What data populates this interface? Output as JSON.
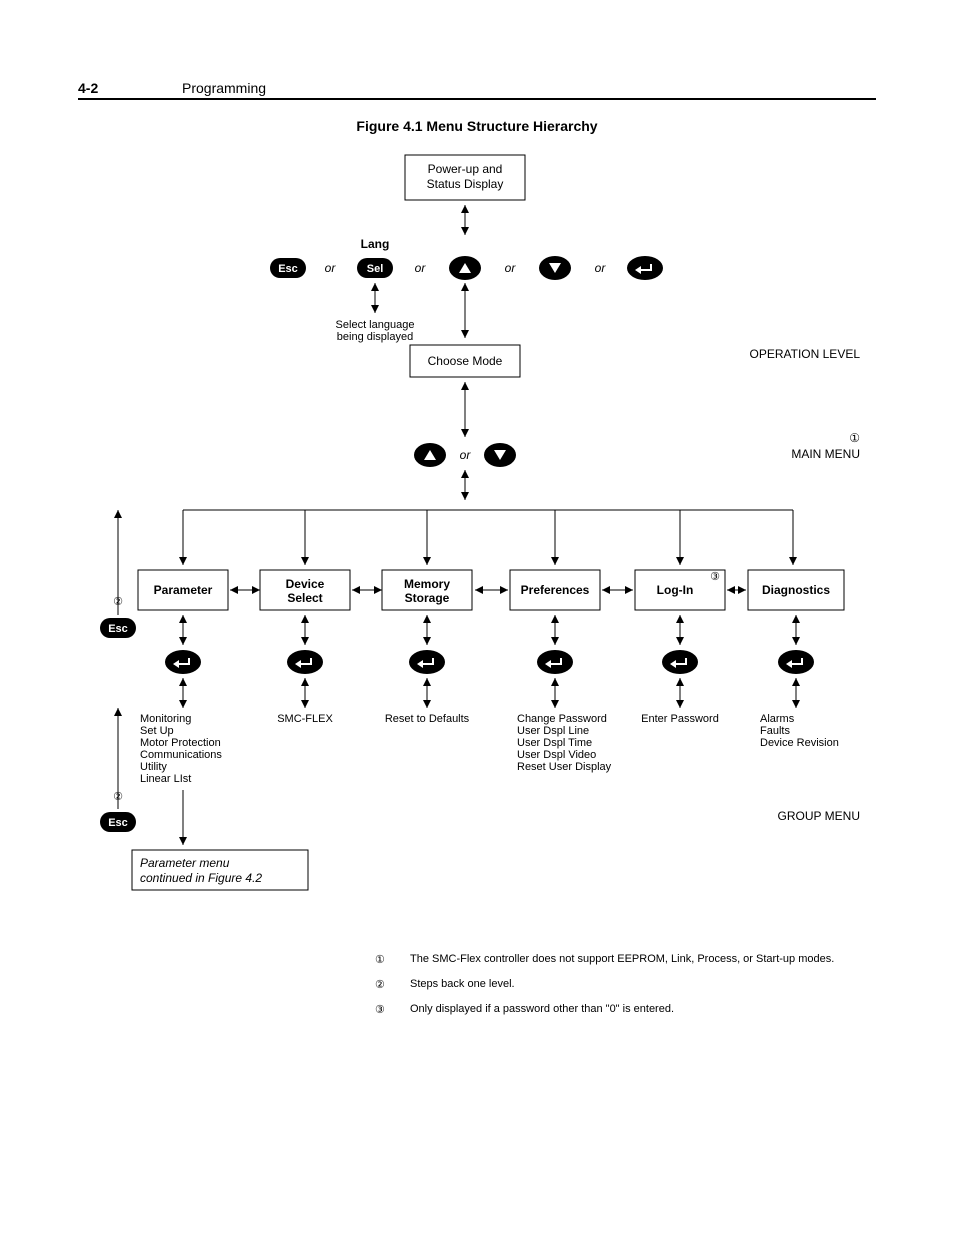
{
  "header": {
    "page": "4-2",
    "section": "Programming"
  },
  "figure": {
    "title": "Figure 4.1   Menu Structure Hierarchy"
  },
  "boxes": {
    "powerup": "Power-up and\nStatus Display",
    "choose": "Choose Mode",
    "parameter": "Parameter",
    "device": "Device\nSelect",
    "memory": "Memory\nStorage",
    "prefs": "Preferences",
    "login": "Log-In",
    "diag": "Diagnostics",
    "paramcont": "Parameter menu\ncontinued in Figure 4.2"
  },
  "labels": {
    "lang": "Lang",
    "or": "or",
    "selectlang": "Select language\nbeing displayed",
    "oplevel": "OPERATION LEVEL",
    "mainmenu": "MAIN MENU",
    "groupmenu": "GROUP MENU",
    "sub_param": "Monitoring\nSet Up\nMotor Protection\nCommunications\nUtility\nLinear LIst",
    "sub_device": "SMC-FLEX",
    "sub_memory": "Reset to Defaults",
    "sub_prefs": "Change Password\nUser Dspl Line\nUser Dspl Time\nUser Dspl Video\nReset User Display",
    "sub_login": "Enter Password",
    "sub_diag": "Alarms\nFaults\nDevice Revision"
  },
  "keys": {
    "esc": "Esc",
    "sel": "Sel"
  },
  "notes": {
    "n1": {
      "sym": "①",
      "text": "The SMC-Flex controller does not support EEPROM, Link, Process, or Start-up modes."
    },
    "n2": {
      "sym": "②",
      "text": "Steps back one level."
    },
    "n3": {
      "sym": "③",
      "text": "Only displayed if a password other than \"0\" is entered."
    }
  },
  "refs": {
    "r1": "①",
    "r2": "②",
    "r3": "③"
  }
}
